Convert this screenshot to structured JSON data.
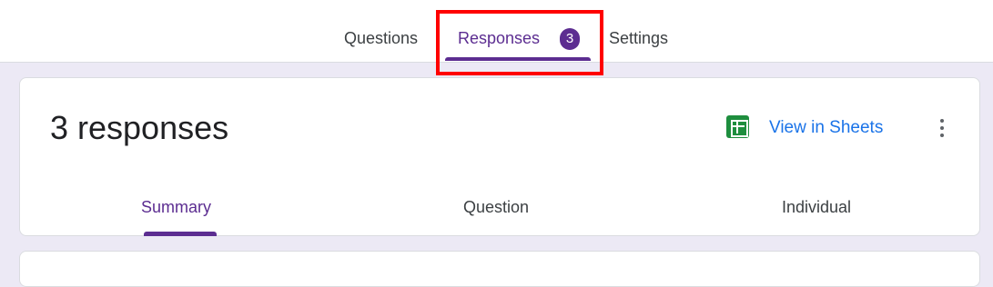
{
  "top_tabs": {
    "questions": "Questions",
    "responses": "Responses",
    "responses_badge": "3",
    "settings": "Settings"
  },
  "summary_card": {
    "response_count": "3 responses",
    "view_in_sheets": "View in Sheets",
    "sheets_icon": "google-sheets-icon",
    "more_icon": "more-vert-icon"
  },
  "sub_tabs": {
    "summary": "Summary",
    "question": "Question",
    "individual": "Individual"
  },
  "colors": {
    "accent": "#5c2d91",
    "link": "#1a73e8",
    "sheets_green": "#1e8e3e",
    "highlight": "#ff0000",
    "background": "#ece9f5"
  }
}
